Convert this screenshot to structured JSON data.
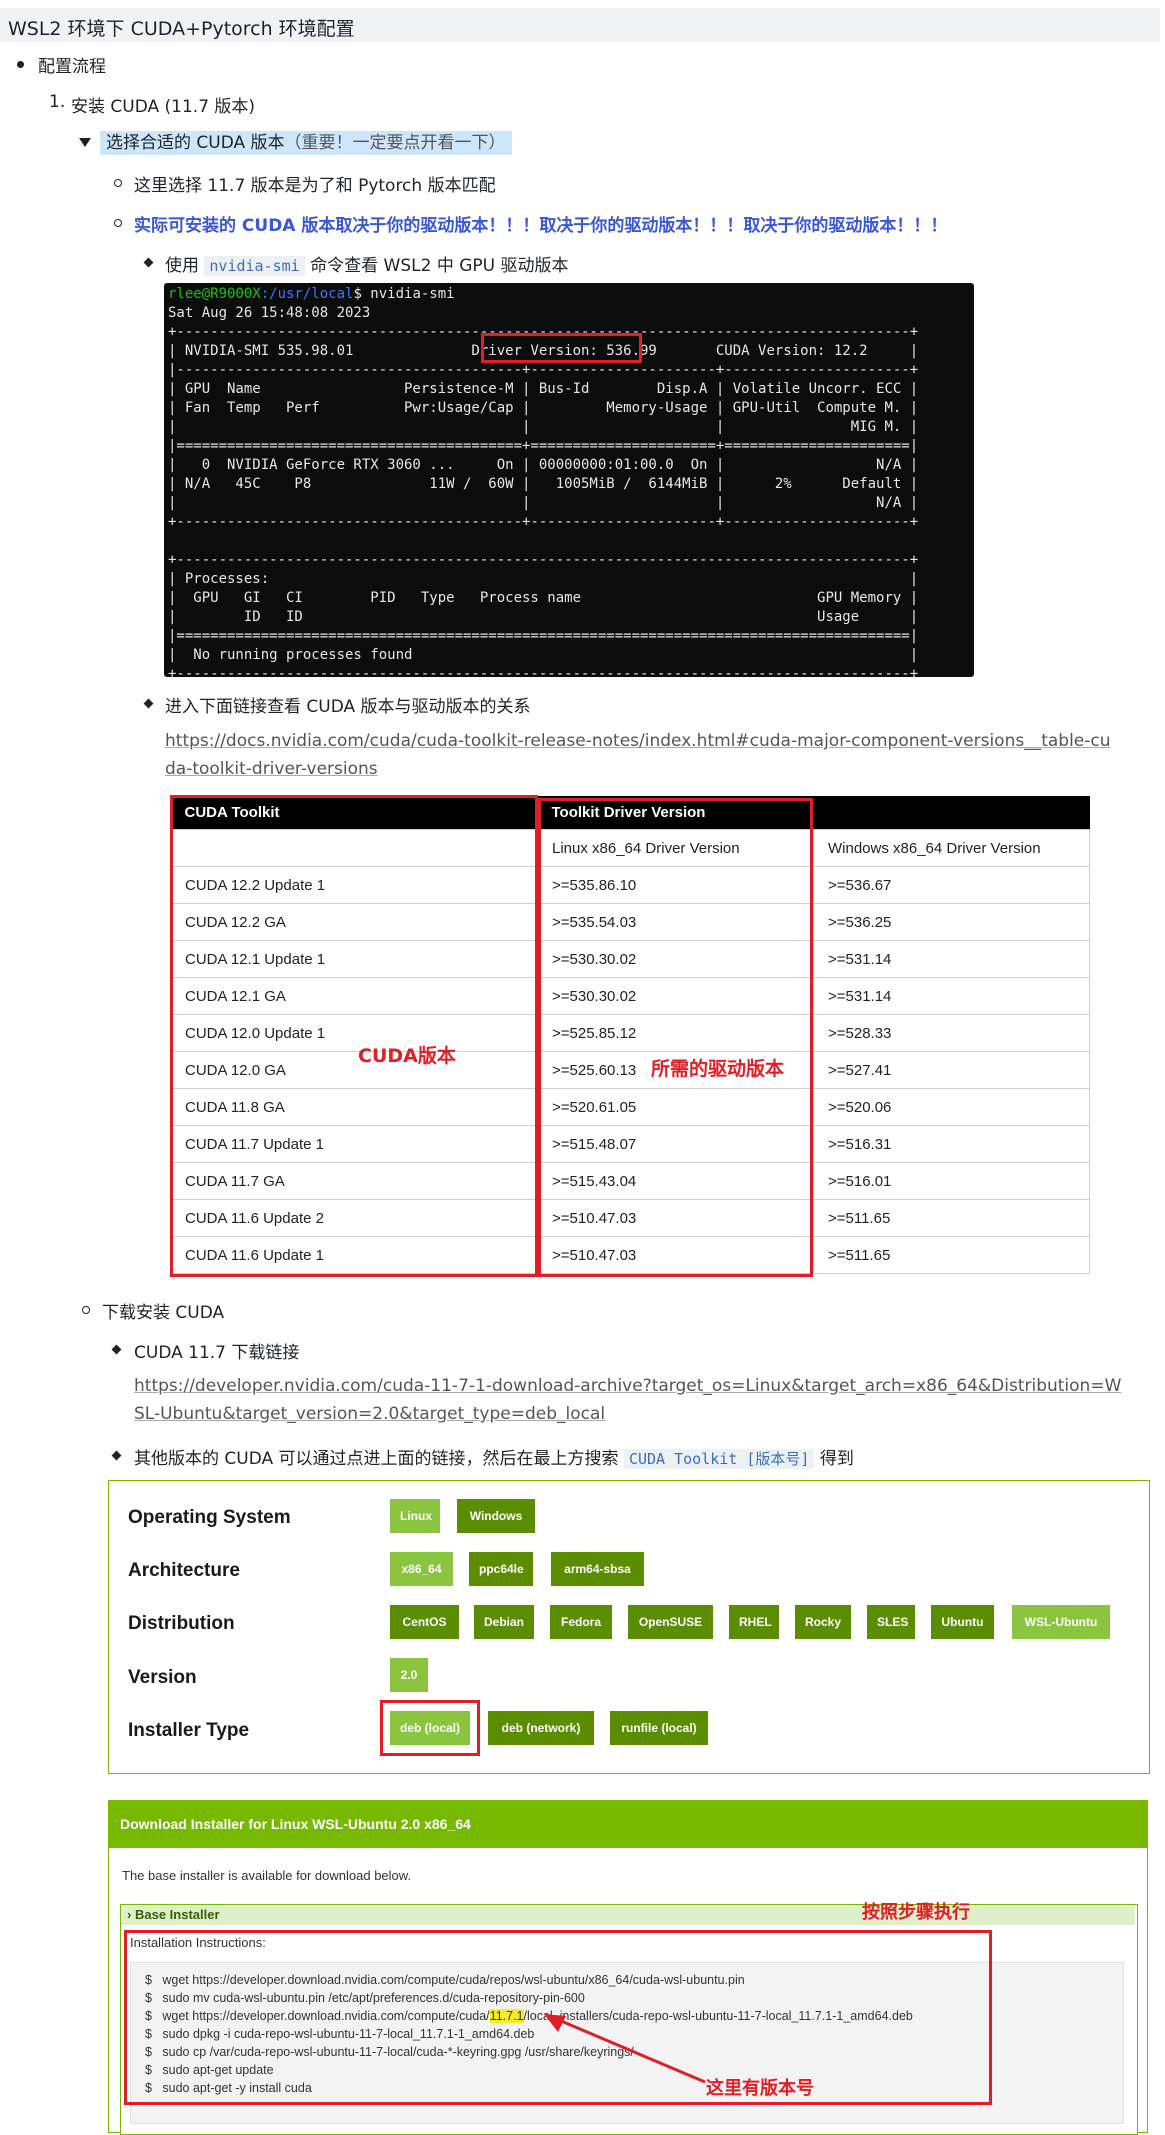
{
  "doc_title": "WSL2 环境下 CUDA+Pytorch 环境配置",
  "l1": "配置流程",
  "l2_num": "1.",
  "l2": "安装 CUDA (11.7 版本)",
  "l3_a": "选择合适的 CUDA 版本",
  "l3_b": "（重要！一定要点开看一下）",
  "l4_1": "这里选择 11.7 版本是为了和 Pytorch 版本匹配",
  "l4_2": "实际可安装的 CUDA 版本取决于你的驱动版本！！！取决于你的驱动版本！！！取决于你的驱动版本！！！",
  "l5_1_pre": "使用",
  "l5_1_code": "nvidia-smi",
  "l5_1_post": "命令查看 WSL2 中 GPU 驱动版本",
  "terminal": {
    "prompt_user": "rlee@R9000X",
    "prompt_path": ":/usr/local",
    "prompt_cmd": "$ nvidia-smi",
    "lines": [
      "Sat Aug 26 15:48:08 2023",
      "+---------------------------------------------------------------------------------------+",
      "| NVIDIA-SMI 535.98.01              Driver Version: 536.99       CUDA Version: 12.2     |",
      "|-----------------------------------------+----------------------+----------------------+",
      "| GPU  Name                 Persistence-M | Bus-Id        Disp.A | Volatile Uncorr. ECC |",
      "| Fan  Temp   Perf          Pwr:Usage/Cap |         Memory-Usage | GPU-Util  Compute M. |",
      "|                                         |                      |               MIG M. |",
      "|=========================================+======================+======================|",
      "|   0  NVIDIA GeForce RTX 3060 ...     On | 00000000:01:00.0  On |                  N/A |",
      "| N/A   45C    P8              11W /  60W |   1005MiB /  6144MiB |      2%      Default |",
      "|                                         |                      |                  N/A |",
      "+-----------------------------------------+----------------------+----------------------+",
      "",
      "+---------------------------------------------------------------------------------------+",
      "| Processes:                                                                            |",
      "|  GPU   GI   CI        PID   Type   Process name                            GPU Memory |",
      "|        ID   ID                                                             Usage      |",
      "|=======================================================================================|",
      "|  No running processes found                                                           |",
      "+---------------------------------------------------------------------------------------+"
    ]
  },
  "l5_2": "进入下面链接查看 CUDA 版本与驱动版本的关系",
  "link1": "https://docs.nvidia.com/cuda/cuda-toolkit-release-notes/index.html#cuda-major-component-versions__table-cuda-toolkit-driver-versions",
  "table": {
    "h1": "CUDA Toolkit",
    "h2": "Toolkit Driver Version",
    "sub2": "Linux x86_64 Driver Version",
    "sub3": "Windows x86_64 Driver Version",
    "rows": [
      [
        "CUDA 12.2 Update 1",
        ">=535.86.10",
        ">=536.67"
      ],
      [
        "CUDA 12.2 GA",
        ">=535.54.03",
        ">=536.25"
      ],
      [
        "CUDA 12.1 Update 1",
        ">=530.30.02",
        ">=531.14"
      ],
      [
        "CUDA 12.1 GA",
        ">=530.30.02",
        ">=531.14"
      ],
      [
        "CUDA 12.0 Update 1",
        ">=525.85.12",
        ">=528.33"
      ],
      [
        "CUDA 12.0 GA",
        ">=525.60.13",
        ">=527.41"
      ],
      [
        "CUDA 11.8 GA",
        ">=520.61.05",
        ">=520.06"
      ],
      [
        "CUDA 11.7 Update 1",
        ">=515.48.07",
        ">=516.31"
      ],
      [
        "CUDA 11.7 GA",
        ">=515.43.04",
        ">=516.01"
      ],
      [
        "CUDA 11.6 Update 2",
        ">=510.47.03",
        ">=511.65"
      ],
      [
        "CUDA 11.6 Update 1",
        ">=510.47.03",
        ">=511.65"
      ]
    ],
    "annot_cuda": "CUDA版本",
    "annot_driver": "所需的驱动版本"
  },
  "l4_3": "下载安装 CUDA",
  "l5_3": "CUDA 11.7 下载链接",
  "link2": "https://developer.nvidia.com/cuda-11-7-1-download-archive?target_os=Linux&target_arch=x86_64&Distribution=WSL-Ubuntu&target_version=2.0&target_type=deb_local",
  "l5_4_pre": "其他版本的 CUDA 可以通过点进上面的链接，然后在最上方搜索",
  "l5_4_code": "CUDA Toolkit [版本号]",
  "l5_4_post": "得到",
  "selector": {
    "os_label": "Operating System",
    "os": [
      "Linux",
      "Windows"
    ],
    "arch_label": "Architecture",
    "arch": [
      "x86_64",
      "ppc64le",
      "arm64-sbsa"
    ],
    "dist_label": "Distribution",
    "dist": [
      "CentOS",
      "Debian",
      "Fedora",
      "OpenSUSE",
      "RHEL",
      "Rocky",
      "SLES",
      "Ubuntu",
      "WSL-Ubuntu"
    ],
    "ver_label": "Version",
    "ver": [
      "2.0"
    ],
    "inst_label": "Installer Type",
    "inst": [
      "deb (local)",
      "deb (network)",
      "runfile (local)"
    ]
  },
  "installer": {
    "header": "Download Installer for Linux WSL-Ubuntu 2.0 x86_64",
    "note": "The base installer is available for download below.",
    "base": "Base Installer",
    "instructions": "Installation Instructions:",
    "annot_follow": "按照步骤执行",
    "annot_version": "这里有版本号",
    "cmd_prefix": "$",
    "cmd1": "wget https://developer.download.nvidia.com/compute/cuda/repos/wsl-ubuntu/x86_64/cuda-wsl-ubuntu.pin",
    "cmd2": "sudo mv cuda-wsl-ubuntu.pin /etc/apt/preferences.d/cuda-repository-pin-600",
    "cmd3_a": "wget https://developer.download.nvidia.com/compute/cuda/",
    "cmd3_ver": "11.7.1",
    "cmd3_b": "/local_installers/cuda-repo-wsl-ubuntu-11-7-local_11.7.1-1_amd64.deb",
    "cmd4": "sudo dpkg -i cuda-repo-wsl-ubuntu-11-7-local_11.7.1-1_amd64.deb",
    "cmd5": "sudo cp /var/cuda-repo-wsl-ubuntu-11-7-local/cuda-*-keyring.gpg /usr/share/keyrings/",
    "cmd6": "sudo apt-get update",
    "cmd7": "sudo apt-get -y install cuda"
  }
}
